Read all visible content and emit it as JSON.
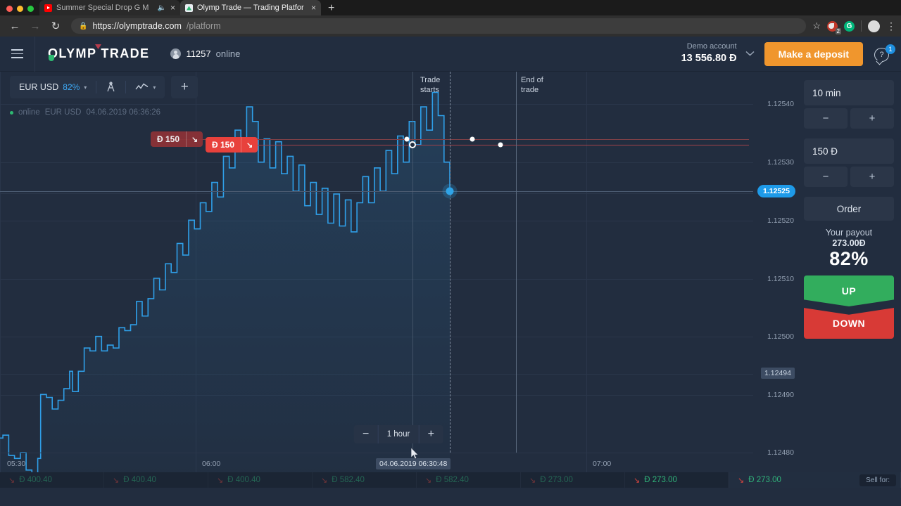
{
  "browser": {
    "tabs": [
      {
        "title": "Summer Special Drop G M",
        "favicon": "youtube-icon",
        "muted_icon": "speaker-icon",
        "active": false
      },
      {
        "title": "Olymp Trade — Trading Platfor",
        "favicon": "olymp-icon",
        "active": true
      }
    ],
    "new_tab_label": "+",
    "nav": {
      "back": "←",
      "forward": "→",
      "reload": "↻"
    },
    "url_domain": "https://olymptrade.com",
    "url_path": "/platform",
    "lock_icon": "lock-icon",
    "star_icon": "star-icon",
    "extension_badge": "2",
    "grammarly_letter": "G",
    "menu_icon": "kebab-menu-icon"
  },
  "header": {
    "menu_icon": "hamburger-icon",
    "logo_text": "OLYMP TRADE",
    "online_count": "11257",
    "online_label": "online",
    "account_label": "Demo account",
    "account_balance": "13 556.80 Đ",
    "account_chevron": "⌄",
    "deposit_button": "Make a deposit",
    "support_badge": "1",
    "support_icon": "help-chat-icon"
  },
  "chart_toolbar": {
    "asset": "EUR USD",
    "asset_payout": "82%",
    "asset_caret": "▾",
    "indicator_icon": "drawing-tools-icon",
    "chart_type_icon": "line-chart-icon",
    "chart_type_caret": "▾",
    "add_button": "+"
  },
  "chart_status": {
    "state": "online",
    "asset": "EUR USD",
    "timestamp": "04.06.2019 06:36:26"
  },
  "chart_markers": {
    "trade_starts_line1": "Trade",
    "trade_starts_line2": "starts",
    "end_of_trade_line1": "End of",
    "end_of_trade_line2": "trade",
    "badge_dim_amount": "Đ 150",
    "badge_dim_arrow": "↘",
    "badge_bright_amount": "Đ 150",
    "badge_bright_arrow": "↘"
  },
  "timeframe": {
    "minus": "−",
    "value": "1 hour",
    "plus": "+"
  },
  "side_panel": {
    "duration_value": "10 min",
    "duration_minus": "−",
    "duration_plus": "+",
    "amount_value": "150 Đ",
    "amount_minus": "−",
    "amount_plus": "+",
    "order_label": "Order",
    "payout_label": "Your payout",
    "payout_amount": "273.00Đ",
    "payout_percent": "82%",
    "up_label": "UP",
    "down_label": "DOWN"
  },
  "ticker": {
    "items": [
      {
        "arrow": "↘",
        "amount": "Đ 400.40",
        "faded": true
      },
      {
        "arrow": "↘",
        "amount": "Đ 400.40",
        "faded": true
      },
      {
        "arrow": "↘",
        "amount": "Đ 400.40",
        "faded": true
      },
      {
        "arrow": "↘",
        "amount": "Đ 582.40",
        "faded": true
      },
      {
        "arrow": "↘",
        "amount": "Đ 582.40",
        "faded": true
      },
      {
        "arrow": "↘",
        "amount": "Đ 273.00",
        "faded": true
      },
      {
        "arrow": "↘",
        "amount": "Đ 273.00",
        "faded": false
      },
      {
        "arrow": "↘",
        "amount": "Đ 273.00",
        "faded": false,
        "sell_label": "Sell for:"
      }
    ]
  },
  "colors": {
    "background": "#222d3f",
    "panel": "#2b3648",
    "accent_blue": "#1e9ae8",
    "line_blue": "#2f9fe8",
    "up_green": "#32ad5d",
    "down_red": "#d83a36",
    "deposit_orange": "#f0962d",
    "grid": "#2a364a"
  },
  "chart_data": {
    "type": "line",
    "title": "EUR USD",
    "xlabel": "",
    "ylabel": "",
    "ylim": [
      1.12475,
      1.12545
    ],
    "xlim": [
      "05:20",
      "07:20"
    ],
    "grid": true,
    "y_ticks": [
      "1.12540",
      "1.12530",
      "1.12520",
      "1.12510",
      "1.12500",
      "1.12490",
      "1.12480"
    ],
    "x_ticks": [
      "05:30",
      "06:00",
      "07:00"
    ],
    "current_price": "1.12525",
    "entry_price_mark": "1.12494",
    "cursor_time_mark": "04.06.2019 06:30:48",
    "series": [
      {
        "name": "EUR USD",
        "points": [
          [
            0,
            1.124825
          ],
          [
            1,
            1.12483
          ],
          [
            3,
            1.124795
          ],
          [
            5,
            1.12479
          ],
          [
            7,
            1.1248
          ],
          [
            9,
            1.12477
          ],
          [
            11,
            1.124765
          ],
          [
            13,
            1.12479
          ],
          [
            14,
            1.1249
          ],
          [
            16,
            1.124895
          ],
          [
            18,
            1.124875
          ],
          [
            20,
            1.12489
          ],
          [
            22,
            1.12491
          ],
          [
            24,
            1.12494
          ],
          [
            25,
            1.124905
          ],
          [
            27,
            1.12494
          ],
          [
            29,
            1.12498
          ],
          [
            31,
            1.124975
          ],
          [
            33,
            1.125
          ],
          [
            35,
            1.124975
          ],
          [
            37,
            1.124985
          ],
          [
            39,
            1.12498
          ],
          [
            41,
            1.125015
          ],
          [
            43,
            1.12501
          ],
          [
            45,
            1.12502
          ],
          [
            47,
            1.12506
          ],
          [
            49,
            1.125035
          ],
          [
            51,
            1.125065
          ],
          [
            53,
            1.1251
          ],
          [
            55,
            1.12508
          ],
          [
            57,
            1.125125
          ],
          [
            59,
            1.12511
          ],
          [
            61,
            1.12516
          ],
          [
            63,
            1.12514
          ],
          [
            65,
            1.1252
          ],
          [
            67,
            1.125185
          ],
          [
            69,
            1.12523
          ],
          [
            71,
            1.125215
          ],
          [
            73,
            1.125265
          ],
          [
            75,
            1.12524
          ],
          [
            77,
            1.12531
          ],
          [
            79,
            1.12529
          ],
          [
            81,
            1.125355
          ],
          [
            83,
            1.12533
          ],
          [
            85,
            1.125395
          ],
          [
            87,
            1.12537
          ],
          [
            89,
            1.1253
          ],
          [
            91,
            1.12534
          ],
          [
            93,
            1.12529
          ],
          [
            95,
            1.125335
          ],
          [
            97,
            1.12528
          ],
          [
            99,
            1.12531
          ],
          [
            101,
            1.12525
          ],
          [
            103,
            1.125295
          ],
          [
            105,
            1.125225
          ],
          [
            107,
            1.125265
          ],
          [
            109,
            1.12521
          ],
          [
            111,
            1.125255
          ],
          [
            113,
            1.125195
          ],
          [
            115,
            1.125245
          ],
          [
            117,
            1.12519
          ],
          [
            119,
            1.125235
          ],
          [
            121,
            1.12518
          ],
          [
            123,
            1.12523
          ],
          [
            125,
            1.125275
          ],
          [
            127,
            1.12523
          ],
          [
            129,
            1.12529
          ],
          [
            131,
            1.12525
          ],
          [
            133,
            1.12532
          ],
          [
            135,
            1.12528
          ],
          [
            137,
            1.125345
          ],
          [
            139,
            1.1253
          ],
          [
            141,
            1.12537
          ],
          [
            143,
            1.12533
          ],
          [
            145,
            1.125395
          ],
          [
            147,
            1.125355
          ],
          [
            149,
            1.12542
          ],
          [
            151,
            1.12538
          ],
          [
            153,
            1.1253
          ],
          [
            155,
            1.12525
          ]
        ]
      }
    ],
    "annotations": [
      {
        "label": "Trade starts",
        "x_ratio": 0.55,
        "style": "dashed-vline"
      },
      {
        "label": "End of trade",
        "x_ratio": 0.686,
        "style": "solid-vline"
      },
      {
        "label": "Đ 150",
        "y": 1.12532,
        "style": "trade-badge-dim"
      },
      {
        "label": "Đ 150",
        "y": 1.125305,
        "style": "trade-badge-bright"
      }
    ]
  }
}
